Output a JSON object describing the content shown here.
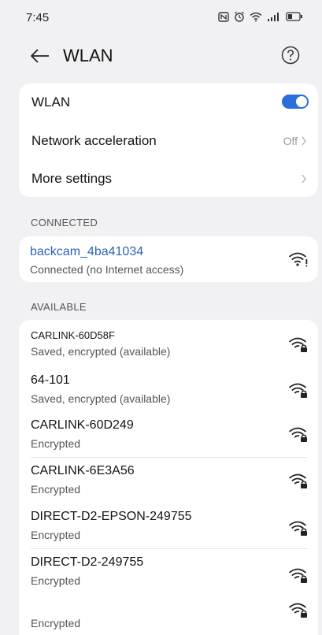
{
  "status_bar": {
    "time": "7:45",
    "icons": [
      "nfc-icon",
      "alarm-icon",
      "wifi-status-icon",
      "signal-icon",
      "battery-icon"
    ]
  },
  "app_bar": {
    "title": "WLAN"
  },
  "settings": {
    "wlan_label": "WLAN",
    "wlan_enabled": true,
    "acceleration_label": "Network acceleration",
    "acceleration_value": "Off",
    "more_label": "More settings"
  },
  "connected": {
    "header": "CONNECTED",
    "name": "backcam_4ba41034",
    "status": "Connected (no Internet access)"
  },
  "available": {
    "header": "AVAILABLE",
    "networks": [
      {
        "name": "CARLINK-60D58F",
        "status": "Saved, encrypted (available)"
      },
      {
        "name": "64-101",
        "status": "Saved, encrypted (available)"
      },
      {
        "name": "CARLINK-60D249",
        "status": "Encrypted"
      },
      {
        "name": "CARLINK-6E3A56",
        "status": "Encrypted"
      },
      {
        "name": "DIRECT-D2-EPSON-249755",
        "status": "Encrypted"
      },
      {
        "name": "DIRECT-D2-249755",
        "status": "Encrypted"
      },
      {
        "name": "",
        "status": "Encrypted"
      }
    ]
  },
  "colors": {
    "accent": "#2a6fdb",
    "connected_name": "#2a63b8",
    "background": "#f1f1f3"
  }
}
